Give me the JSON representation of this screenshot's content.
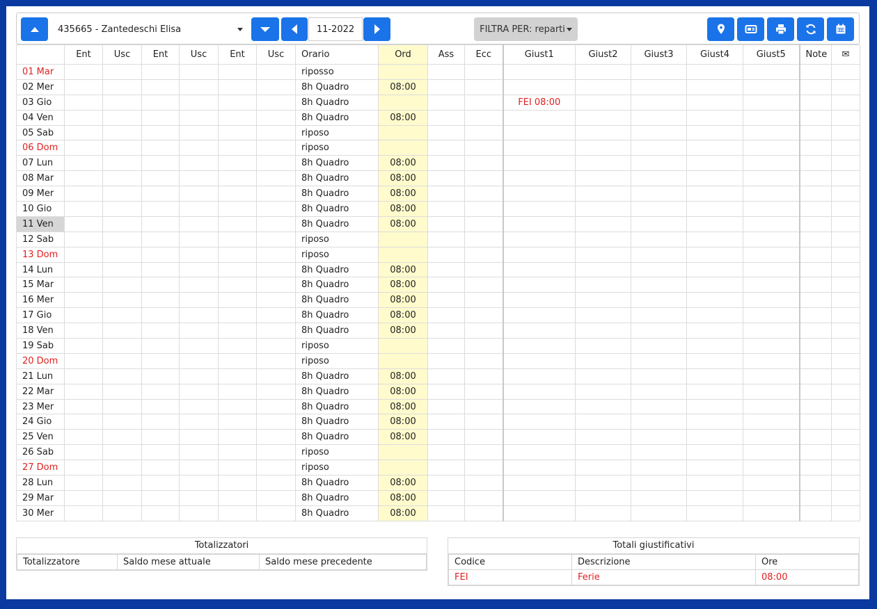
{
  "toolbar": {
    "employee": "435665 - Zantedeschi Elisa",
    "period": "11-2022",
    "filter_label": "FILTRA PER: reparti",
    "icons": [
      "arrow-up-icon",
      "arrow-down-icon",
      "prev-icon",
      "next-icon",
      "map-pin-icon",
      "badge-card-icon",
      "print-icon",
      "refresh-icon",
      "calendar-icon"
    ]
  },
  "grid": {
    "headers": [
      "",
      "Ent",
      "Usc",
      "Ent",
      "Usc",
      "Ent",
      "Usc",
      "Orario",
      "Ord",
      "Ass",
      "Ecc",
      "Giust1",
      "Giust2",
      "Giust3",
      "Giust4",
      "Giust5",
      "Note",
      "✉"
    ],
    "rows": [
      {
        "day": "01 Mar",
        "orario": "riposso",
        "ord": "",
        "giust1": "",
        "holiday": true
      },
      {
        "day": "02 Mer",
        "orario": "8h Quadro",
        "ord": "08:00",
        "giust1": ""
      },
      {
        "day": "03 Gio",
        "orario": "8h Quadro",
        "ord": "",
        "giust1": "FEI 08:00"
      },
      {
        "day": "04 Ven",
        "orario": "8h Quadro",
        "ord": "08:00",
        "giust1": ""
      },
      {
        "day": "05 Sab",
        "orario": "riposo",
        "ord": "",
        "giust1": ""
      },
      {
        "day": "06 Dom",
        "orario": "riposo",
        "ord": "",
        "giust1": "",
        "holiday": true
      },
      {
        "day": "07 Lun",
        "orario": "8h Quadro",
        "ord": "08:00",
        "giust1": ""
      },
      {
        "day": "08 Mar",
        "orario": "8h Quadro",
        "ord": "08:00",
        "giust1": ""
      },
      {
        "day": "09 Mer",
        "orario": "8h Quadro",
        "ord": "08:00",
        "giust1": ""
      },
      {
        "day": "10 Gio",
        "orario": "8h Quadro",
        "ord": "08:00",
        "giust1": ""
      },
      {
        "day": "11 Ven",
        "orario": "8h Quadro",
        "ord": "08:00",
        "giust1": "",
        "selected": true
      },
      {
        "day": "12 Sab",
        "orario": "riposo",
        "ord": "",
        "giust1": ""
      },
      {
        "day": "13 Dom",
        "orario": "riposo",
        "ord": "",
        "giust1": "",
        "holiday": true
      },
      {
        "day": "14 Lun",
        "orario": "8h Quadro",
        "ord": "08:00",
        "giust1": ""
      },
      {
        "day": "15 Mar",
        "orario": "8h Quadro",
        "ord": "08:00",
        "giust1": ""
      },
      {
        "day": "16 Mer",
        "orario": "8h Quadro",
        "ord": "08:00",
        "giust1": ""
      },
      {
        "day": "17 Gio",
        "orario": "8h Quadro",
        "ord": "08:00",
        "giust1": ""
      },
      {
        "day": "18 Ven",
        "orario": "8h Quadro",
        "ord": "08:00",
        "giust1": ""
      },
      {
        "day": "19 Sab",
        "orario": "riposo",
        "ord": "",
        "giust1": ""
      },
      {
        "day": "20 Dom",
        "orario": "riposo",
        "ord": "",
        "giust1": "",
        "holiday": true
      },
      {
        "day": "21 Lun",
        "orario": "8h Quadro",
        "ord": "08:00",
        "giust1": ""
      },
      {
        "day": "22 Mar",
        "orario": "8h Quadro",
        "ord": "08:00",
        "giust1": ""
      },
      {
        "day": "23 Mer",
        "orario": "8h Quadro",
        "ord": "08:00",
        "giust1": ""
      },
      {
        "day": "24 Gio",
        "orario": "8h Quadro",
        "ord": "08:00",
        "giust1": ""
      },
      {
        "day": "25 Ven",
        "orario": "8h Quadro",
        "ord": "08:00",
        "giust1": ""
      },
      {
        "day": "26 Sab",
        "orario": "riposo",
        "ord": "",
        "giust1": ""
      },
      {
        "day": "27 Dom",
        "orario": "riposo",
        "ord": "",
        "giust1": "",
        "holiday": true
      },
      {
        "day": "28 Lun",
        "orario": "8h Quadro",
        "ord": "08:00",
        "giust1": ""
      },
      {
        "day": "29 Mar",
        "orario": "8h Quadro",
        "ord": "08:00",
        "giust1": ""
      },
      {
        "day": "30 Mer",
        "orario": "8h Quadro",
        "ord": "08:00",
        "giust1": ""
      }
    ]
  },
  "totalizzatori": {
    "title": "Totalizzatori",
    "headers": [
      "Totalizzatore",
      "Saldo mese attuale",
      "Saldo mese precedente"
    ]
  },
  "totali_giustificativi": {
    "title": "Totali giustificativi",
    "headers": [
      "Codice",
      "Descrizione",
      "Ore"
    ],
    "rows": [
      {
        "codice": "FEI",
        "descrizione": "Ferie",
        "ore": "08:00"
      }
    ]
  },
  "colors": {
    "accent": "#1a73e8",
    "holiday_text": "#e02020",
    "ord_column_bg": "#fffbcc",
    "page_bg": "#0a3aa0"
  }
}
